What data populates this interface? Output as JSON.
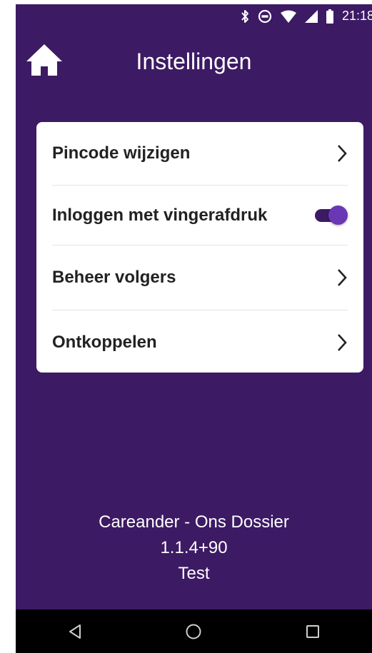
{
  "status_bar": {
    "time": "21:18",
    "icons": [
      "bluetooth-icon",
      "do-not-disturb-icon",
      "wifi-icon",
      "signal-icon",
      "battery-icon"
    ]
  },
  "app_bar": {
    "title": "Instellingen",
    "home_icon": "home-icon"
  },
  "settings": {
    "items": [
      {
        "label": "Pincode wijzigen",
        "control": "chevron"
      },
      {
        "label": "Inloggen met vingerafdruk",
        "control": "toggle",
        "enabled": true
      },
      {
        "label": "Beheer volgers",
        "control": "chevron"
      },
      {
        "label": "Ontkoppelen",
        "control": "chevron"
      }
    ]
  },
  "footer": {
    "app_name": "Careander - Ons Dossier",
    "version": "1.1.4+90",
    "environment": "Test"
  },
  "nav_bar": {
    "icons": [
      "back-icon",
      "home-nav-icon",
      "recents-icon"
    ]
  },
  "colors": {
    "background": "#3d1a64",
    "card": "#ffffff",
    "toggle_thumb": "#6a37b5",
    "nav_bar": "#000000"
  }
}
